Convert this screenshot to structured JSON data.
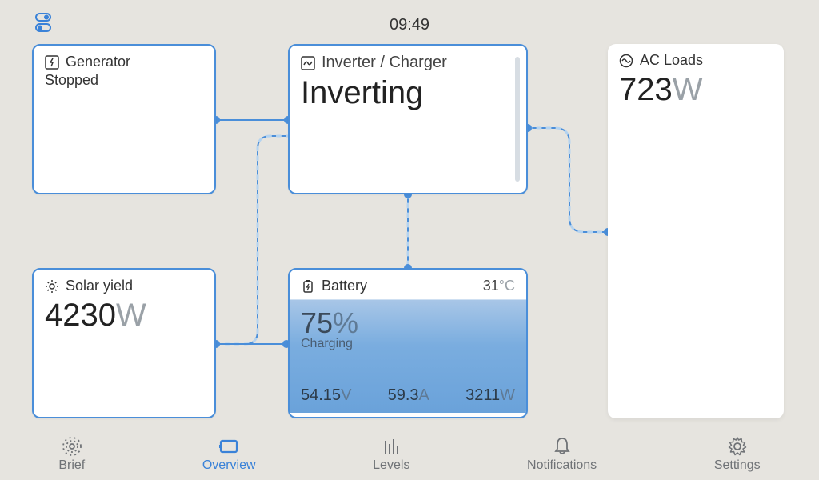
{
  "clock": "09:49",
  "generator": {
    "title": "Generator",
    "status": "Stopped"
  },
  "inverter": {
    "title": "Inverter / Charger",
    "status": "Inverting"
  },
  "acloads": {
    "title": "AC Loads",
    "value": "723",
    "unit": "W"
  },
  "solar": {
    "title": "Solar yield",
    "value": "4230",
    "unit": "W"
  },
  "battery": {
    "title": "Battery",
    "temp_value": "31",
    "temp_unit": "°C",
    "pct": "75",
    "pct_unit": "%",
    "state": "Charging",
    "voltage": "54.15",
    "voltage_unit": "V",
    "current": "59.3",
    "current_unit": "A",
    "power": "3211",
    "power_unit": "W"
  },
  "nav": {
    "brief": "Brief",
    "overview": "Overview",
    "levels": "Levels",
    "notifications": "Notifications",
    "settings": "Settings"
  }
}
